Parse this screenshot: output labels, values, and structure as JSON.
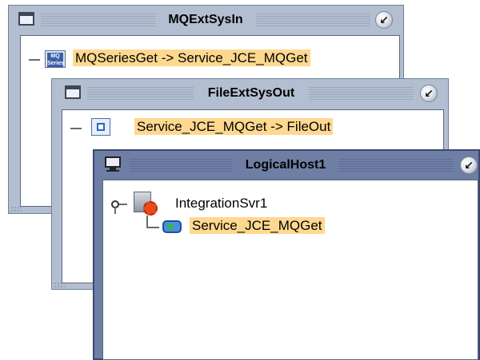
{
  "windows": [
    {
      "title": "MQExtSysIn",
      "items": [
        {
          "icon": "mqseries-icon",
          "icon_text": "MQ Series",
          "label": "MQSeriesGet -> Service_JCE_MQGet",
          "highlighted": true
        }
      ]
    },
    {
      "title": "FileExtSysOut",
      "items": [
        {
          "icon": "file-document-icon",
          "label": "Service_JCE_MQGet -> FileOut",
          "highlighted": true
        }
      ]
    },
    {
      "title": "LogicalHost1",
      "tree": {
        "root": {
          "icon": "server-icon",
          "label": "IntegrationSvr1"
        },
        "child": {
          "icon": "service-icon",
          "label": "Service_JCE_MQGet",
          "highlighted": true
        }
      }
    }
  ],
  "minimize_glyph": "↙",
  "colors": {
    "inactive_frame": "#b3bfd1",
    "active_frame": "#6f7ea4",
    "highlight": "#ffd890"
  }
}
